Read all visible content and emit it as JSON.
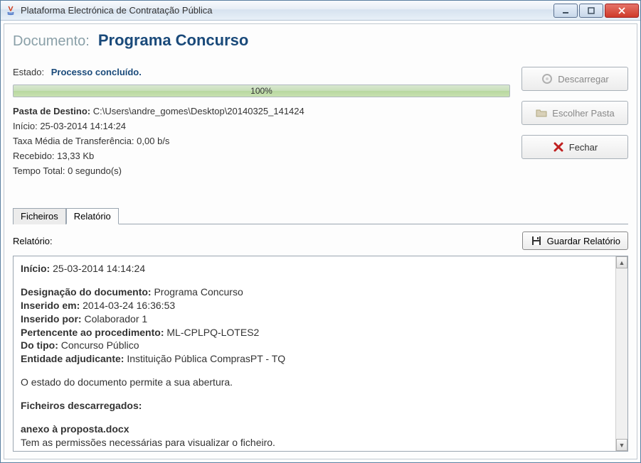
{
  "window": {
    "title": "Plataforma Electrónica de Contratação Pública"
  },
  "header": {
    "label": "Documento:",
    "value": "Programa Concurso"
  },
  "status": {
    "label": "Estado:",
    "value": "Processo concluído."
  },
  "progress": {
    "text": "100%"
  },
  "info": {
    "dest_label": "Pasta de Destino:",
    "dest_value": "C:\\Users\\andre_gomes\\Desktop\\20140325_141424",
    "start_label": "Início:",
    "start_value": "25-03-2014 14:14:24",
    "rate_label": "Taxa Média de Transferência:",
    "rate_value": "0,00 b/s",
    "received_label": "Recebido:",
    "received_value": "13,33 Kb",
    "total_label": "Tempo Total:",
    "total_value": "0 segundo(s)"
  },
  "buttons": {
    "download": "Descarregar",
    "choose": "Escolher Pasta",
    "close": "Fechar"
  },
  "tabs": {
    "files": "Ficheiros",
    "report": "Relatório"
  },
  "report": {
    "label": "Relatório:",
    "save": "Guardar Relatório",
    "inicio_label": "Início:",
    "inicio_value": "25-03-2014 14:14:24",
    "designacao_label": "Designação do documento:",
    "designacao_value": "Programa Concurso",
    "inserido_em_label": "Inserido em:",
    "inserido_em_value": "2014-03-24 16:36:53",
    "inserido_por_label": "Inserido por:",
    "inserido_por_value": "Colaborador 1",
    "procedimento_label": "Pertencente ao procedimento:",
    "procedimento_value": "ML-CPLPQ-LOTES2",
    "tipo_label": "Do tipo:",
    "tipo_value": "Concurso Público",
    "entidade_label": "Entidade adjudicante:",
    "entidade_value": "Instituição Pública ComprasPT - TQ",
    "estado_doc": "O estado do documento permite a sua abertura.",
    "ficheiros_header": "Ficheiros descarregados:",
    "ficheiro_nome": "anexo à proposta.docx",
    "ficheiro_perm": "Tem as permissões necessárias para visualizar o ficheiro."
  }
}
